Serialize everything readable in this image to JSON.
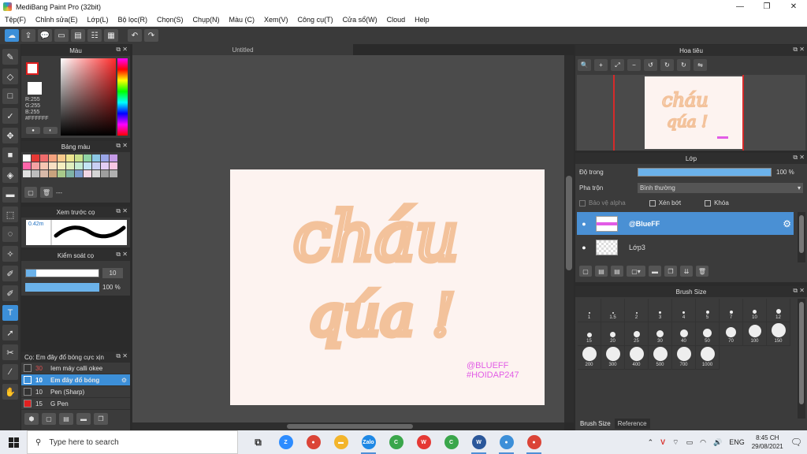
{
  "window": {
    "title": "MediBang Paint Pro (32bit)",
    "controls": [
      "—",
      "❐",
      "✕"
    ]
  },
  "menu": [
    "Tệp(F)",
    "Chỉnh sửa(E)",
    "Lớp(L)",
    "Bộ lọc(R)",
    "Chọn(S)",
    "Chụp(N)",
    "Màu (C)",
    "Xem(V)",
    "Công cụ(T)",
    "Cửa sổ(W)",
    "Cloud",
    "Help"
  ],
  "color_panel": {
    "title": "Màu",
    "rgb": [
      "R:255",
      "G:255",
      "B:255"
    ],
    "hex": "#FFFFFF",
    "btn1": "●",
    "btn2": "◐"
  },
  "palette_panel": {
    "title": "Bảng màu",
    "colors": [
      "#ffffff",
      "#e53935",
      "#ef6c6c",
      "#f4a27e",
      "#f7c98b",
      "#ece48f",
      "#c8e08b",
      "#8fd3a4",
      "#8cc8e6",
      "#9aa6e8",
      "#c49ae6",
      "#ff66aa",
      "#f4a3a3",
      "#f6c7b2",
      "#f9e0c4",
      "#f5efc0",
      "#e0efbf",
      "#c5ebd2",
      "#c3e4f4",
      "#c9cff4",
      "#e3cdf4",
      "#f9c6e3",
      "#e0e0e0",
      "#bdbdbd",
      "#d8b9a8",
      "#c9a37e",
      "#a8c98a",
      "#7fb3a6",
      "#7c9ccc",
      "#f2d7e4",
      "#d6d6d6",
      "#9e9e9e",
      "#b0b0b0"
    ],
    "empty": "---"
  },
  "preview_panel": {
    "title": "Xem trước cọ",
    "size": "0.42m"
  },
  "control_panel": {
    "title": "Kiểm soát cọ",
    "size_value": "10",
    "opacity_value": "100 %",
    "opacity": 1.0,
    "size_fill": 1.0
  },
  "brush_panel": {
    "title": "Cọ: Em đây đổ bóng cực xịn",
    "items": [
      {
        "num": "30",
        "name": "Iem máy calli okee",
        "color": "#333333",
        "num_color": "#e05050"
      },
      {
        "num": "10",
        "name": "Em đây đổ bóng",
        "color": "#3c8fd8",
        "num_color": "#ffffff"
      },
      {
        "num": "10",
        "name": "Pen (Sharp)",
        "color": "#333333",
        "num_color": "#dddddd"
      },
      {
        "num": "15",
        "name": "G Pen",
        "color": "#e02020",
        "num_color": "#dddddd"
      }
    ]
  },
  "canvas": {
    "tab": "Untitled",
    "word1": "cháu",
    "word2": "qúa !",
    "tag1": "@BLUEFF",
    "tag2": "#HOIDAP247",
    "stroke_color": "#f3c29b",
    "tag_color": "#e25ce6"
  },
  "navigator": {
    "title": "Hoa tiêu",
    "tools": [
      "🔍",
      "+",
      "⤢",
      "−",
      "↺",
      "↻",
      "↻",
      "⇋"
    ]
  },
  "layer_panel": {
    "title": "Lớp",
    "opacity_label": "Độ trong",
    "opacity_value": "100 %",
    "opacity": 1.0,
    "blend_label": "Pha trộn",
    "blend_value": "Bình thường",
    "protect_alpha": "Bảo vệ alpha",
    "clipping": "Xén bớt",
    "lock": "Khóa",
    "layers": [
      {
        "name": "@BlueFF",
        "selected": true
      },
      {
        "name": "Lớp3",
        "selected": false
      }
    ]
  },
  "brush_size": {
    "title": "Brush Size",
    "sizes": [
      "1",
      "1.5",
      "2",
      "3",
      "4",
      "5",
      "7",
      "10",
      "12",
      "15",
      "20",
      "25",
      "30",
      "40",
      "50",
      "70",
      "100",
      "150",
      "200",
      "300",
      "400",
      "500",
      "700",
      "1000"
    ],
    "tabs": [
      "Brush Size",
      "Reference"
    ]
  },
  "taskbar": {
    "search_placeholder": "Type here to search",
    "lang": "ENG",
    "time": "8:45 CH",
    "date": "29/08/2021",
    "apps": [
      {
        "name": "task-view",
        "label": "⧉",
        "color": "#555555",
        "running": false
      },
      {
        "name": "zoom",
        "label": "Z",
        "color": "#2d8cff",
        "running": false
      },
      {
        "name": "chrome",
        "label": "●",
        "color": "#db4437",
        "running": false
      },
      {
        "name": "file-explorer",
        "label": "▬",
        "color": "#f3b52b",
        "running": false
      },
      {
        "name": "zalo",
        "label": "Zalo",
        "color": "#1e88e5",
        "running": true
      },
      {
        "name": "coccoc",
        "label": "C",
        "color": "#3aa64b",
        "running": false
      },
      {
        "name": "wps",
        "label": "W",
        "color": "#e53935",
        "running": false
      },
      {
        "name": "coccoc-2",
        "label": "C",
        "color": "#3aa64b",
        "running": false
      },
      {
        "name": "word",
        "label": "W",
        "color": "#2b579a",
        "running": true
      },
      {
        "name": "medibang",
        "label": "●",
        "color": "#3c8fd8",
        "running": true
      },
      {
        "name": "chrome-2",
        "label": "●",
        "color": "#db4437",
        "running": true
      }
    ]
  }
}
